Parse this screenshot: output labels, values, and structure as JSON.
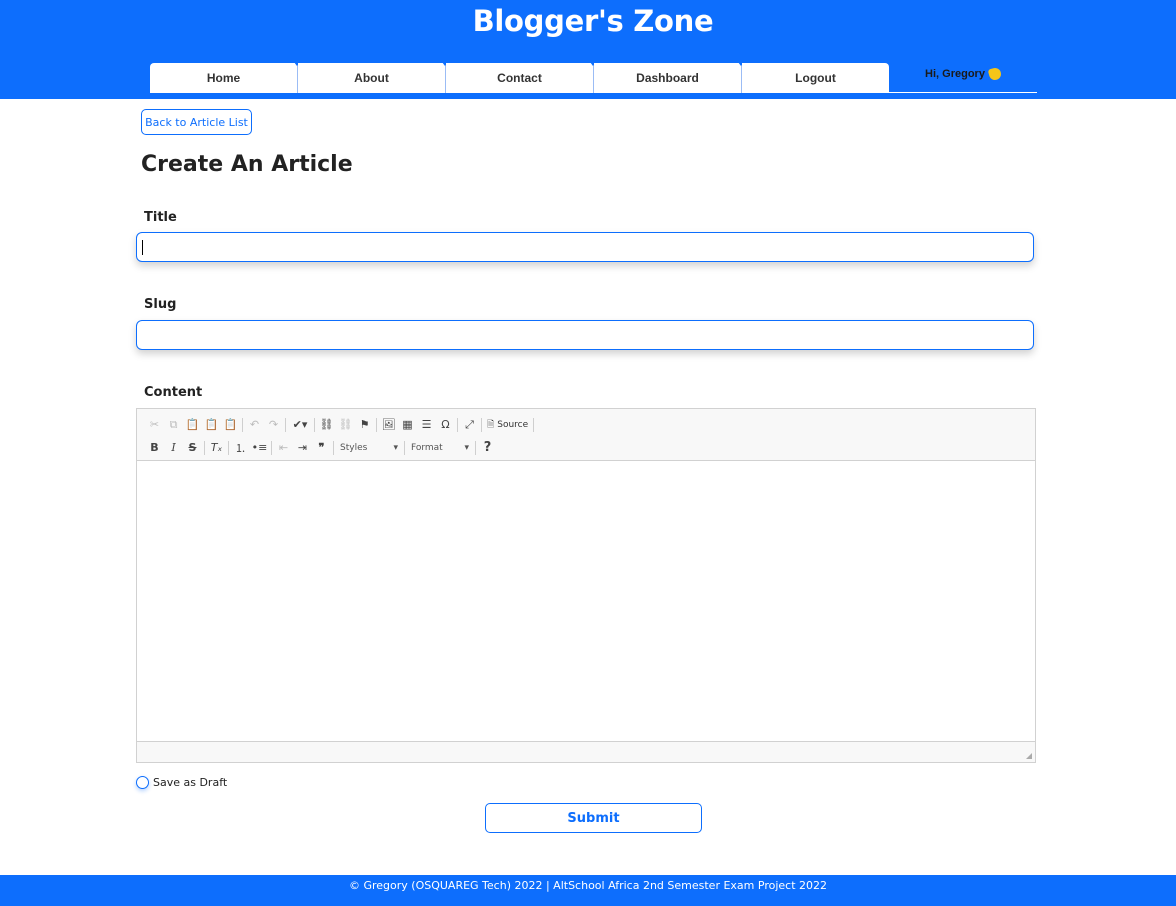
{
  "header": {
    "site_title": "Blogger's Zone",
    "brand_color": "#0d6efd"
  },
  "nav": {
    "items": [
      {
        "label": "Home"
      },
      {
        "label": "About"
      },
      {
        "label": "Contact"
      },
      {
        "label": "Dashboard"
      },
      {
        "label": "Logout"
      }
    ],
    "greeting": "Hi, Gregory",
    "greeting_icon": "waving-hand-icon"
  },
  "main": {
    "back_label": "Back to Article List",
    "page_title": "Create An Article",
    "title_label": "Title",
    "title_value": "",
    "slug_label": "Slug",
    "slug_value": "",
    "content_label": "Content",
    "editor": {
      "styles_label": "Styles",
      "format_label": "Format",
      "source_label": "Source"
    },
    "draft_label": "Save as Draft",
    "submit_label": "Submit"
  },
  "footer": {
    "text": "© Gregory (OSQUAREG Tech) 2022 | AltSchool Africa 2nd Semester Exam Project 2022"
  }
}
